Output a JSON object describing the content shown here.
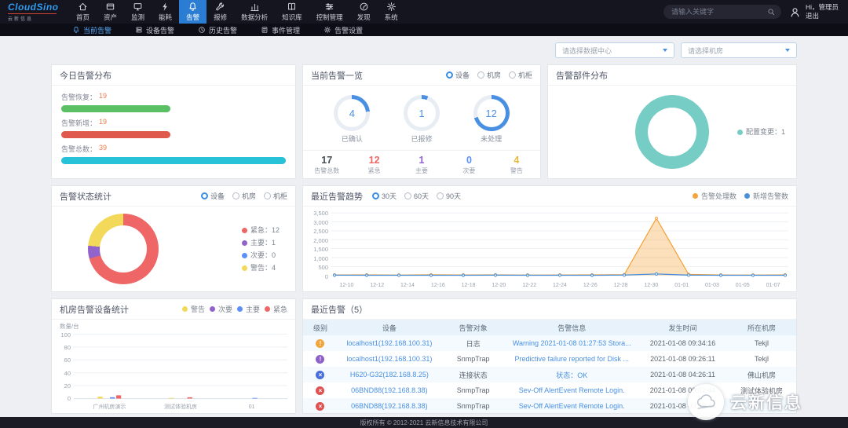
{
  "header": {
    "logo_title": "CloudSino",
    "logo_subtitle": "云新信息",
    "nav": [
      {
        "label": "首页",
        "icon": "home-icon"
      },
      {
        "label": "资产",
        "icon": "asset-icon"
      },
      {
        "label": "监测",
        "icon": "monitor-icon"
      },
      {
        "label": "能耗",
        "icon": "energy-icon"
      },
      {
        "label": "告警",
        "icon": "alarm-icon",
        "active": true
      },
      {
        "label": "报修",
        "icon": "repair-icon"
      },
      {
        "label": "数据分析",
        "icon": "analysis-icon"
      },
      {
        "label": "知识库",
        "icon": "knowledge-icon"
      },
      {
        "label": "控制管理",
        "icon": "control-icon"
      },
      {
        "label": "发现",
        "icon": "discover-icon"
      },
      {
        "label": "系统",
        "icon": "system-icon"
      }
    ],
    "search_placeholder": "请输入关键字",
    "greeting": "Hi，管理员",
    "logout": "退出"
  },
  "subnav": [
    {
      "label": "当前告警",
      "icon": "bell-icon",
      "active": true
    },
    {
      "label": "设备告警",
      "icon": "server-icon"
    },
    {
      "label": "历史告警",
      "icon": "clock-icon"
    },
    {
      "label": "事件管理",
      "icon": "event-icon"
    },
    {
      "label": "告警设置",
      "icon": "gear-icon"
    }
  ],
  "filters": {
    "datacenter_placeholder": "请选择数据中心",
    "room_placeholder": "请选择机房"
  },
  "panels": {
    "today": {
      "title": "今日告警分布",
      "bars": [
        {
          "label": "告警恢复",
          "value": 19,
          "color": "#5bbf63"
        },
        {
          "label": "告警新增",
          "value": 19,
          "color": "#df5a4c"
        },
        {
          "label": "告警总数",
          "value": 39,
          "color": "#27c2d8"
        }
      ]
    },
    "overview": {
      "title": "当前告警一览",
      "radios": [
        {
          "label": "设备",
          "selected": true
        },
        {
          "label": "机房"
        },
        {
          "label": "机柜"
        }
      ],
      "total": 17,
      "ring_color": "#4a90e2",
      "rings": [
        {
          "value": 4,
          "label": "已确认"
        },
        {
          "value": 1,
          "label": "已报修"
        },
        {
          "value": 12,
          "label": "未处理"
        }
      ],
      "stats": [
        {
          "value": 17,
          "label": "告警总数",
          "color": "#454c55"
        },
        {
          "value": 12,
          "label": "紧急",
          "color": "#ee6666"
        },
        {
          "value": 1,
          "label": "主要",
          "color": "#9163cb"
        },
        {
          "value": 0,
          "label": "次要",
          "color": "#5b8ff9"
        },
        {
          "value": 4,
          "label": "警告",
          "color": "#e6b93d"
        }
      ]
    },
    "component": {
      "title": "告警部件分布",
      "slices": [
        {
          "label": "配置变更",
          "value": 1,
          "color": "#76cdc5"
        }
      ]
    },
    "status": {
      "title": "告警状态统计",
      "radios": [
        {
          "label": "设备",
          "selected": true
        },
        {
          "label": "机房"
        },
        {
          "label": "机柜"
        }
      ],
      "slices": [
        {
          "label": "紧急",
          "value": 12,
          "color": "#ee6666"
        },
        {
          "label": "主要",
          "value": 1,
          "color": "#9163cb"
        },
        {
          "label": "次要",
          "value": 0,
          "color": "#5b8ff9"
        },
        {
          "label": "警告",
          "value": 4,
          "color": "#f3d95a"
        }
      ]
    },
    "trend": {
      "title": "最近告警趋势",
      "radios": [
        {
          "label": "30天",
          "selected": true
        },
        {
          "label": "60天"
        },
        {
          "label": "90天"
        }
      ],
      "legend": [
        {
          "label": "告警处理数",
          "color": "#f5a33b"
        },
        {
          "label": "新增告警数",
          "color": "#4a90d9"
        }
      ],
      "chart_data": {
        "type": "line",
        "x": [
          "12-10",
          "12-12",
          "12-14",
          "12-16",
          "12-18",
          "12-20",
          "12-22",
          "12-24",
          "12-26",
          "12-28",
          "12-30",
          "01-01",
          "01-03",
          "01-05",
          "01-07"
        ],
        "y_ticks": [
          "3,500",
          "3,000",
          "2,500",
          "2,000",
          "1,500",
          "1,000",
          "500",
          "0"
        ],
        "ymax": 3500,
        "series": [
          {
            "name": "告警处理数",
            "color": "#f5a33b",
            "area": true,
            "values": [
              25,
              30,
              20,
              35,
              25,
              30,
              20,
              25,
              30,
              45,
              3200,
              60,
              25,
              20,
              30
            ]
          },
          {
            "name": "新增告警数",
            "color": "#4a90d9",
            "values": [
              15,
              10,
              12,
              8,
              10,
              14,
              9,
              12,
              10,
              20,
              80,
              18,
              10,
              8,
              12
            ]
          }
        ]
      }
    },
    "roomstat": {
      "title": "机房告警设备统计",
      "chart_data": {
        "type": "bar",
        "ylabel": "数量/台",
        "y_ticks": [
          100,
          80,
          60,
          40,
          20,
          0
        ],
        "ymax": 100,
        "categories": [
          "广州机房演示",
          "测试体验机房",
          "01"
        ],
        "series": [
          {
            "name": "警告",
            "color": "#f3d95a",
            "values": [
              3,
              1,
              0
            ]
          },
          {
            "name": "次要",
            "color": "#9163cb",
            "values": [
              0,
              0,
              0
            ]
          },
          {
            "name": "主要",
            "color": "#5b8ff9",
            "values": [
              2,
              0,
              1
            ]
          },
          {
            "name": "紧急",
            "color": "#ee6666",
            "values": [
              5,
              2,
              0
            ]
          }
        ]
      }
    },
    "recent": {
      "title": "最近告警（5）",
      "headers": [
        "级别",
        "设备",
        "告警对象",
        "告警信息",
        "发生时间",
        "所在机房"
      ],
      "rows": [
        {
          "level": "warning",
          "glyph": "!",
          "color": "#f2a53a",
          "device": "localhost1(192.168.100.31)",
          "object": "日志",
          "info": "Warning 2021-01-08 01:27:53 Stora...",
          "time": "2021-01-08 09:34:16",
          "room": "Tekjl"
        },
        {
          "level": "major",
          "glyph": "!",
          "color": "#8e5fc7",
          "device": "localhost1(192.168.100.31)",
          "object": "SnmpTrap",
          "info": "Predictive failure reported for Disk ...",
          "time": "2021-01-08 09:26:11",
          "room": "Tekjl"
        },
        {
          "level": "info",
          "glyph": "×",
          "color": "#4a6fdc",
          "device": "H620-G32(182.168.8.25)",
          "object": "连接状态",
          "info": "状态：OK",
          "time": "2021-01-08 04:26:11",
          "room": "佛山机房"
        },
        {
          "level": "critical",
          "glyph": "×",
          "color": "#e05252",
          "device": "06BND88(192.168.8.38)",
          "object": "SnmpTrap",
          "info": "Sev-Off AlertEvent Remote Login.",
          "time": "2021-01-08 00:52:44",
          "room": "测试体验机房"
        },
        {
          "level": "critical",
          "glyph": "×",
          "color": "#e05252",
          "device": "06BND88(192.168.8.38)",
          "object": "SnmpTrap",
          "info": "Sev-Off AlertEvent Remote Login.",
          "time": "2021-01-08 00:52:44",
          "room": ""
        }
      ]
    }
  },
  "footer": "版权所有 © 2012-2021 云新信息技术有限公司",
  "watermark": "云新信息"
}
